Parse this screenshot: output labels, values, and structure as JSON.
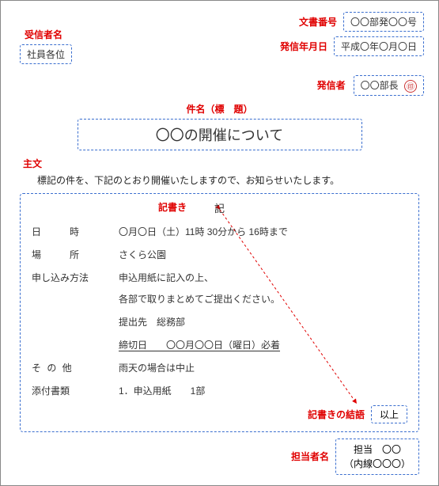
{
  "labels": {
    "doc_no": "文書番号",
    "send_date": "発信年月日",
    "recipient": "受信者名",
    "sender": "発信者",
    "subject": "件名（標　題）",
    "main": "主文",
    "ki": "記書き",
    "ki_char": "記",
    "closing": "記書きの結語",
    "person": "担当者名"
  },
  "doc_no": "〇〇部発〇〇号",
  "send_date": "平成〇年〇月〇日",
  "recipient": "社員各位",
  "sender_text": "〇〇部長",
  "seal": "㊞",
  "subject": "〇〇の開催について",
  "maintext": "標記の件を、下記のとおり開催いたしますので、お知らせいたします。",
  "rows": {
    "datetime": {
      "label": "日　　時",
      "value": "〇月〇日（土）11時 30分から 16時まで"
    },
    "place": {
      "label": "場　　所",
      "value": "さくら公園"
    },
    "apply": {
      "label": "申し込み方法",
      "value1": "申込用紙に記入の上、",
      "value2": "各部で取りまとめてご提出ください。",
      "sub1": "提出先　総務部",
      "sub2": "締切日　　〇〇月〇〇日（曜日）必着"
    },
    "other": {
      "label": "そ の 他",
      "value": "雨天の場合は中止"
    },
    "attach": {
      "label": "添付書類",
      "value": "1．申込用紙　　1部"
    }
  },
  "ijo": "以上",
  "tantou": {
    "line1": "担当　〇〇",
    "line2": "（内線〇〇〇）"
  }
}
